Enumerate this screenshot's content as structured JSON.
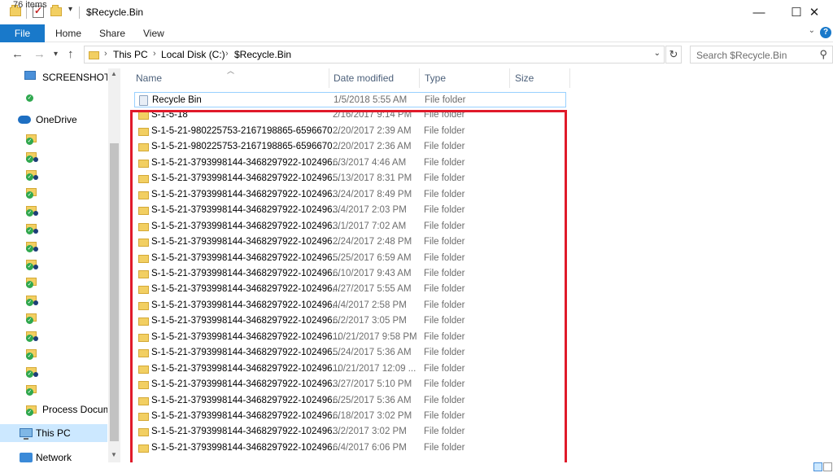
{
  "window": {
    "title": "$Recycle.Bin",
    "minimize": "—",
    "maximize": "☐",
    "close": "✕"
  },
  "ribbon": {
    "tabs": [
      "File",
      "Home",
      "Share",
      "View"
    ]
  },
  "addressbar": {
    "crumbs": [
      "This PC",
      "Local Disk (C:)",
      "$Recycle.Bin"
    ]
  },
  "search": {
    "placeholder": "Search $Recycle.Bin"
  },
  "navpane": {
    "screenshot_label": "SCREENSHOT PC",
    "onedrive_label": "OneDrive",
    "process_label": "Process Docume",
    "thispc_label": "This PC",
    "network_label": "Network"
  },
  "columns": {
    "name": "Name",
    "date": "Date modified",
    "type": "Type",
    "size": "Size"
  },
  "files": [
    {
      "name": "Recycle Bin",
      "date": "1/5/2018 5:55 AM",
      "type": "File folder",
      "icon": "recycle-bin-icon"
    },
    {
      "name": "S-1-5-18",
      "date": "2/16/2017 9:14 PM",
      "type": "File folder",
      "icon": "folder-icon"
    },
    {
      "name": "S-1-5-21-980225753-2167198865-6596670...",
      "date": "2/20/2017 2:39 AM",
      "type": "File folder",
      "icon": "folder-icon"
    },
    {
      "name": "S-1-5-21-980225753-2167198865-6596670...",
      "date": "2/20/2017 2:36 AM",
      "type": "File folder",
      "icon": "folder-icon"
    },
    {
      "name": "S-1-5-21-3793998144-3468297922-102496...",
      "date": "6/3/2017 4:46 AM",
      "type": "File folder",
      "icon": "folder-icon"
    },
    {
      "name": "S-1-5-21-3793998144-3468297922-102496...",
      "date": "5/13/2017 8:31 PM",
      "type": "File folder",
      "icon": "folder-icon"
    },
    {
      "name": "S-1-5-21-3793998144-3468297922-102496...",
      "date": "3/24/2017 8:49 PM",
      "type": "File folder",
      "icon": "folder-icon"
    },
    {
      "name": "S-1-5-21-3793998144-3468297922-102496...",
      "date": "3/4/2017 2:03 PM",
      "type": "File folder",
      "icon": "folder-icon"
    },
    {
      "name": "S-1-5-21-3793998144-3468297922-102496...",
      "date": "3/1/2017 7:02 AM",
      "type": "File folder",
      "icon": "folder-icon"
    },
    {
      "name": "S-1-5-21-3793998144-3468297922-102496...",
      "date": "2/24/2017 2:48 PM",
      "type": "File folder",
      "icon": "folder-icon"
    },
    {
      "name": "S-1-5-21-3793998144-3468297922-102496...",
      "date": "5/25/2017 6:59 AM",
      "type": "File folder",
      "icon": "folder-icon"
    },
    {
      "name": "S-1-5-21-3793998144-3468297922-102496...",
      "date": "6/10/2017 9:43 AM",
      "type": "File folder",
      "icon": "folder-icon"
    },
    {
      "name": "S-1-5-21-3793998144-3468297922-102496...",
      "date": "4/27/2017 5:55 AM",
      "type": "File folder",
      "icon": "folder-icon"
    },
    {
      "name": "S-1-5-21-3793998144-3468297922-102496...",
      "date": "4/4/2017 2:58 PM",
      "type": "File folder",
      "icon": "folder-icon"
    },
    {
      "name": "S-1-5-21-3793998144-3468297922-102496...",
      "date": "6/2/2017 3:05 PM",
      "type": "File folder",
      "icon": "folder-icon"
    },
    {
      "name": "S-1-5-21-3793998144-3468297922-102496...",
      "date": "10/21/2017 9:58 PM",
      "type": "File folder",
      "icon": "folder-icon"
    },
    {
      "name": "S-1-5-21-3793998144-3468297922-102496...",
      "date": "5/24/2017 5:36 AM",
      "type": "File folder",
      "icon": "folder-icon"
    },
    {
      "name": "S-1-5-21-3793998144-3468297922-102496...",
      "date": "10/21/2017 12:09 ...",
      "type": "File folder",
      "icon": "folder-icon"
    },
    {
      "name": "S-1-5-21-3793998144-3468297922-102496...",
      "date": "3/27/2017 5:10 PM",
      "type": "File folder",
      "icon": "folder-icon"
    },
    {
      "name": "S-1-5-21-3793998144-3468297922-102496...",
      "date": "6/25/2017 5:36 AM",
      "type": "File folder",
      "icon": "folder-icon"
    },
    {
      "name": "S-1-5-21-3793998144-3468297922-102496...",
      "date": "6/18/2017 3:02 PM",
      "type": "File folder",
      "icon": "folder-icon"
    },
    {
      "name": "S-1-5-21-3793998144-3468297922-102496...",
      "date": "3/2/2017 3:02 PM",
      "type": "File folder",
      "icon": "folder-icon"
    },
    {
      "name": "S-1-5-21-3793998144-3468297922-102496...",
      "date": "6/4/2017 6:06 PM",
      "type": "File folder",
      "icon": "folder-icon"
    }
  ],
  "status": {
    "item_count": "76 items"
  },
  "colors": {
    "accent": "#1979ca",
    "selection": "#cce8ff",
    "highlight_border": "#e01a2a",
    "folder": "#f2cf62"
  }
}
